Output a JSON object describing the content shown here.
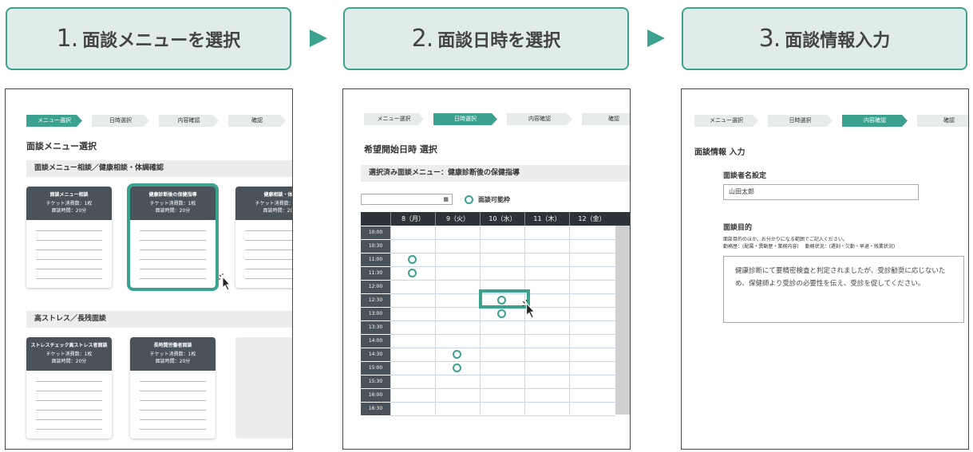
{
  "steps": [
    {
      "num": "1.",
      "label": "面談メニューを選択"
    },
    {
      "num": "2.",
      "label": "面談日時を選択"
    },
    {
      "num": "3.",
      "label": "面談情報入力"
    }
  ],
  "crumbs": [
    "メニュー選択",
    "日時選択",
    "内容確認",
    "確認"
  ],
  "p1": {
    "title": "面談メニュー選択",
    "sec1": "面談メニュー相談／健康相談・体調確認",
    "sec2": "高ストレス／長残面談",
    "cards1": [
      {
        "t": "面談メニュー相談",
        "a": "チケット消費数：1枚",
        "b": "面談時間：20分"
      },
      {
        "t": "健康診断後の保健指導",
        "a": "チケット消費数：1枚",
        "b": "面談時間：20分"
      },
      {
        "t": "健康相談・体",
        "a": "チケット消費数：1枚",
        "b": "面談時間：20"
      }
    ],
    "cards2": [
      {
        "t": "ストレスチェック高ストレス者面談",
        "a": "チケット消費数：1枚",
        "b": "面談時間：20分"
      },
      {
        "t": "長時間労働者面談",
        "a": "チケット消費数：1枚",
        "b": "面談時間：20分"
      }
    ]
  },
  "p2": {
    "title": "希望開始日時 選択",
    "selected": "選択済み面談メニュー：健康診断後の保健指導",
    "legend": "面談可能枠",
    "days": [
      "8（月）",
      "9（火）",
      "10（水）",
      "11（木）",
      "12（金）"
    ],
    "times": [
      "10:00",
      "10:30",
      "11:00",
      "11:30",
      "12:00",
      "12:30",
      "13:00",
      "13:30",
      "14:00",
      "14:30",
      "15:00",
      "15:30",
      "16:00",
      "16:30"
    ]
  },
  "p3": {
    "section": "面談情報 入力",
    "nameLabel": "面談者名設定",
    "nameValue": "山田太郎",
    "purposeLabel": "面談目的",
    "hint1": "面談目的のほか、お分かりになる範囲でご記入ください。",
    "hint2": "勤務歴：(配属・異動歴・業務内容)　 勤務状況：(遅刻・欠勤・早退・残業状況)",
    "purposeText": "健康診断にて要精密検査と判定されましたが、受診勧奨に応じないため、保健師より受診の必要性を伝え、受診を促してください。"
  },
  "colors": {
    "accent": "#3aa28e",
    "dark": "#4a5359",
    "light": "#dfecea"
  }
}
